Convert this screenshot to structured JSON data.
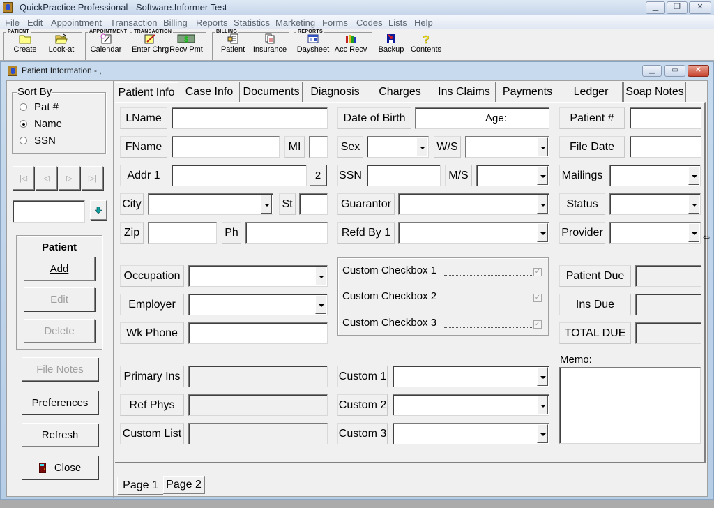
{
  "app": {
    "title": "QuickPractice Professional - Software.Informer Test",
    "window_buttons": {
      "minimize": "▁",
      "restore": "❐",
      "close": "✕"
    }
  },
  "menu": [
    "File",
    "Edit",
    "Appointment",
    "Transaction",
    "Billing",
    "Reports",
    "Statistics",
    "Marketing",
    "Forms",
    "Codes",
    "Lists",
    "Help"
  ],
  "toolbar": {
    "groups": [
      {
        "label": "PATIENT",
        "buttons": [
          {
            "label": "Create",
            "icon": "folder-icon"
          },
          {
            "label": "Look-at",
            "icon": "open-folder-icon"
          }
        ]
      },
      {
        "label": "APPOINTMENT",
        "buttons": [
          {
            "label": "Calendar",
            "icon": "calendar-icon"
          }
        ]
      },
      {
        "label": "TRANSACTION",
        "buttons": [
          {
            "label": "Enter Chrg",
            "icon": "pencil-form-icon"
          },
          {
            "label": "Recv Pmt",
            "icon": "money-icon"
          }
        ]
      },
      {
        "label": "BILLING",
        "buttons": [
          {
            "label": "Patient",
            "icon": "patient-bill-icon"
          },
          {
            "label": "Insurance",
            "icon": "insurance-doc-icon"
          }
        ]
      },
      {
        "label": "REPORTS",
        "buttons": [
          {
            "label": "Daysheet",
            "icon": "daysheet-icon"
          },
          {
            "label": "Acc Recv",
            "icon": "bar-books-icon"
          }
        ]
      }
    ],
    "extra": [
      {
        "label": "Backup",
        "icon": "floppy-disk-icon"
      },
      {
        "label": "Contents",
        "icon": "question-mark-icon"
      }
    ]
  },
  "child": {
    "title": "Patient Information - ,",
    "sort_by": {
      "title": "Sort By",
      "options": [
        {
          "label": "Pat #",
          "selected": false
        },
        {
          "label": "Name",
          "selected": true
        },
        {
          "label": "SSN",
          "selected": false
        }
      ]
    },
    "nav_buttons": [
      "|◁",
      "◁",
      "▷",
      "▷|"
    ],
    "search_value": "",
    "patient_group": {
      "title": "Patient",
      "add": "Add",
      "edit": "Edit",
      "delete": "Delete"
    },
    "side_buttons": {
      "file_notes": "File Notes",
      "preferences": "Preferences",
      "refresh": "Refresh",
      "close": "Close"
    },
    "tabs": [
      "Patient Info",
      "Case Info",
      "Documents",
      "Diagnosis",
      "Charges",
      "Ins Claims",
      "Payments",
      "Ledger",
      "Soap Notes"
    ],
    "active_tab": "Patient Info",
    "form": {
      "lname": {
        "label": "LName",
        "value": ""
      },
      "fname": {
        "label": "FName",
        "value": ""
      },
      "mi": {
        "label": "MI",
        "value": ""
      },
      "addr1": {
        "label": "Addr  1",
        "value": ""
      },
      "addr2_button": "2",
      "city": {
        "label": "City",
        "value": ""
      },
      "st": {
        "label": "St",
        "value": ""
      },
      "zip": {
        "label": "Zip",
        "value": ""
      },
      "ph": {
        "label": "Ph",
        "value": ""
      },
      "dob": {
        "label": "Date of Birth",
        "age_label": "Age:"
      },
      "sex": {
        "label": "Sex",
        "value": ""
      },
      "ws": {
        "label": "W/S",
        "value": ""
      },
      "ssn": {
        "label": "SSN",
        "value": ""
      },
      "ms": {
        "label": "M/S",
        "value": ""
      },
      "guarantor": {
        "label": "Guarantor",
        "value": ""
      },
      "refd_by": {
        "label": "Refd By 1",
        "value": ""
      },
      "patient_no": {
        "label": "Patient #",
        "value": ""
      },
      "file_date": {
        "label": "File Date",
        "value": ""
      },
      "mailings": {
        "label": "Mailings",
        "value": ""
      },
      "status": {
        "label": "Status",
        "value": ""
      },
      "provider": {
        "label": "Provider",
        "value": ""
      },
      "occupation": {
        "label": "Occupation",
        "value": ""
      },
      "employer": {
        "label": "Employer",
        "value": ""
      },
      "wk_phone": {
        "label": "Wk Phone",
        "value": ""
      },
      "custom_checkboxes": [
        {
          "label": "Custom Checkbox 1",
          "checked": true
        },
        {
          "label": "Custom Checkbox 2",
          "checked": true
        },
        {
          "label": "Custom Checkbox 3",
          "checked": true
        }
      ],
      "patient_due": {
        "label": "Patient Due",
        "value": ""
      },
      "ins_due": {
        "label": "Ins Due",
        "value": ""
      },
      "total_due": {
        "label": "TOTAL DUE",
        "value": ""
      },
      "primary_ins": {
        "label": "Primary Ins",
        "value": ""
      },
      "ref_phys": {
        "label": "Ref Phys",
        "value": ""
      },
      "custom_list": {
        "label": "Custom List",
        "value": ""
      },
      "custom1": {
        "label": "Custom 1",
        "value": ""
      },
      "custom2": {
        "label": "Custom 2",
        "value": ""
      },
      "custom3": {
        "label": "Custom 3",
        "value": ""
      },
      "memo": {
        "label": "Memo:",
        "value": ""
      }
    },
    "page_tabs": [
      "Page 1",
      "Page 2"
    ],
    "active_page": "Page 1"
  }
}
